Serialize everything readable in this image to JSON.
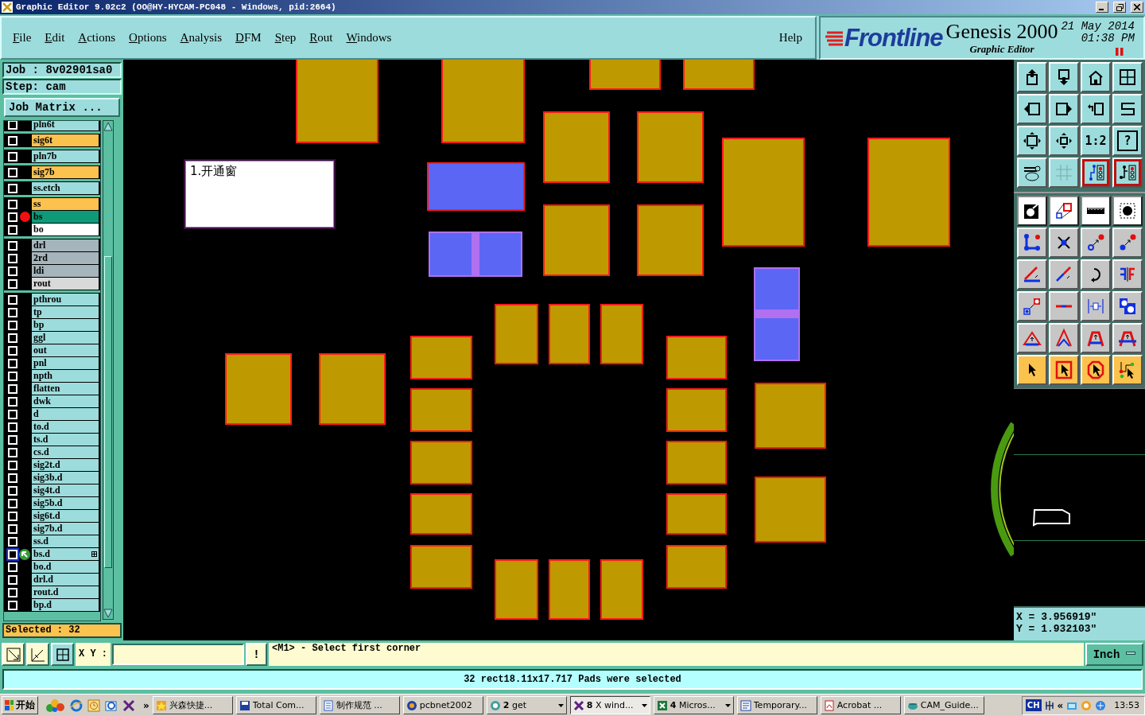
{
  "window": {
    "title": "Graphic Editor 9.02c2 (OO@HY-HYCAM-PC048 - Windows, pid:2664)"
  },
  "menu": [
    {
      "label": "File"
    },
    {
      "label": "Edit"
    },
    {
      "label": "Actions"
    },
    {
      "label": "Options"
    },
    {
      "label": "Analysis"
    },
    {
      "label": "DFM"
    },
    {
      "label": "Step"
    },
    {
      "label": "Rout"
    },
    {
      "label": "Windows"
    }
  ],
  "help": "Help",
  "brand": {
    "logo": "Frontline",
    "product": "Genesis 2000",
    "date": "21 May 2014",
    "time": "01:38 PM",
    "subtitle": "Graphic Editor"
  },
  "job": {
    "job": "Job : 8v02901sa0",
    "step": "Step: cam",
    "matrix_button": "Job Matrix ..."
  },
  "layer_groups": [
    {
      "layers": [
        {
          "name": "pln6t",
          "color": "#9ddcdc",
          "checked": false,
          "work": false,
          "current": false
        }
      ]
    },
    {
      "layers": [
        {
          "name": "sig6t",
          "color": "#fbc24e",
          "checked": false,
          "work": false,
          "current": false
        }
      ]
    },
    {
      "layers": [
        {
          "name": "pln7b",
          "color": "#9ddcdc",
          "checked": false,
          "work": false,
          "current": false
        }
      ]
    },
    {
      "layers": [
        {
          "name": "sig7b",
          "color": "#fbc24e",
          "checked": false,
          "work": false,
          "current": false
        }
      ]
    },
    {
      "layers": [
        {
          "name": "ss.etch",
          "color": "#9ddcdc",
          "checked": false,
          "work": false,
          "current": false
        }
      ]
    },
    {
      "layers": [
        {
          "name": "ss",
          "color": "#fbc24e",
          "checked": false,
          "work": false,
          "current": false
        },
        {
          "name": "bs",
          "color": "#0e9a78",
          "checked": false,
          "work": true,
          "current": false
        },
        {
          "name": "bo",
          "color": "#ffffff",
          "checked": false,
          "work": false,
          "current": false
        }
      ]
    },
    {
      "layers": [
        {
          "name": "drl",
          "color": "#a5b5bb",
          "checked": false,
          "work": false,
          "current": false
        },
        {
          "name": "2rd",
          "color": "#a5b5bb",
          "checked": false,
          "work": false,
          "current": false
        },
        {
          "name": "ldi",
          "color": "#a5b5bb",
          "checked": false,
          "work": false,
          "current": false
        },
        {
          "name": "rout",
          "color": "#d9d9d9",
          "checked": false,
          "work": false,
          "current": false
        }
      ]
    },
    {
      "layers": [
        {
          "name": "pthrou",
          "color": "#9ddcdc",
          "checked": false,
          "work": false,
          "current": false
        },
        {
          "name": "tp",
          "color": "#9ddcdc",
          "checked": false,
          "work": false,
          "current": false
        },
        {
          "name": "bp",
          "color": "#9ddcdc",
          "checked": false,
          "work": false,
          "current": false
        },
        {
          "name": "ggl",
          "color": "#9ddcdc",
          "checked": false,
          "work": false,
          "current": false
        },
        {
          "name": "out",
          "color": "#9ddcdc",
          "checked": false,
          "work": false,
          "current": false
        },
        {
          "name": "pnl",
          "color": "#9ddcdc",
          "checked": false,
          "work": false,
          "current": false
        },
        {
          "name": "npth",
          "color": "#9ddcdc",
          "checked": false,
          "work": false,
          "current": false
        },
        {
          "name": "flatten",
          "color": "#9ddcdc",
          "checked": false,
          "work": false,
          "current": false
        },
        {
          "name": "dwk",
          "color": "#9ddcdc",
          "checked": false,
          "work": false,
          "current": false
        },
        {
          "name": "d",
          "color": "#9ddcdc",
          "checked": false,
          "work": false,
          "current": false
        },
        {
          "name": "to.d",
          "color": "#9ddcdc",
          "checked": false,
          "work": false,
          "current": false
        },
        {
          "name": "ts.d",
          "color": "#9ddcdc",
          "checked": false,
          "work": false,
          "current": false
        },
        {
          "name": "cs.d",
          "color": "#9ddcdc",
          "checked": false,
          "work": false,
          "current": false
        },
        {
          "name": "sig2t.d",
          "color": "#9ddcdc",
          "checked": false,
          "work": false,
          "current": false
        },
        {
          "name": "sig3b.d",
          "color": "#9ddcdc",
          "checked": false,
          "work": false,
          "current": false
        },
        {
          "name": "sig4t.d",
          "color": "#9ddcdc",
          "checked": false,
          "work": false,
          "current": false
        },
        {
          "name": "sig5b.d",
          "color": "#9ddcdc",
          "checked": false,
          "work": false,
          "current": false
        },
        {
          "name": "sig6t.d",
          "color": "#9ddcdc",
          "checked": false,
          "work": false,
          "current": false
        },
        {
          "name": "sig7b.d",
          "color": "#9ddcdc",
          "checked": false,
          "work": false,
          "current": false
        },
        {
          "name": "ss.d",
          "color": "#9ddcdc",
          "checked": false,
          "work": false,
          "current": false
        },
        {
          "name": "bs.d",
          "color": "#9ddcdc",
          "checked": false,
          "work": false,
          "current": true
        },
        {
          "name": "bo.d",
          "color": "#9ddcdc",
          "checked": false,
          "work": false,
          "current": false
        },
        {
          "name": "drl.d",
          "color": "#9ddcdc",
          "checked": false,
          "work": false,
          "current": false
        },
        {
          "name": "rout.d",
          "color": "#9ddcdc",
          "checked": false,
          "work": false,
          "current": false
        },
        {
          "name": "bp.d",
          "color": "#9ddcdc",
          "checked": false,
          "work": false,
          "current": false
        }
      ]
    }
  ],
  "selected_count": "Selected : 32",
  "canvas": {
    "note": "1.开通窗",
    "pads": [
      {
        "kind": "rect",
        "color": "#bf9900",
        "selected": true
      },
      {
        "kind": "rect",
        "color": "#bf9900",
        "selected": true
      },
      {
        "kind": "rect",
        "color": "#bf9900",
        "selected": true
      },
      {
        "kind": "rect",
        "color": "#bf9900",
        "selected": true
      },
      {
        "kind": "rect",
        "color": "#bf9900",
        "selected": true
      },
      {
        "kind": "rect",
        "color": "#bf9900",
        "selected": true
      },
      {
        "kind": "rect",
        "color": "#bf9900",
        "selected": true
      },
      {
        "kind": "rect",
        "color": "#bf9900",
        "selected": true
      },
      {
        "kind": "rect",
        "color": "#bf9900",
        "selected": true
      },
      {
        "kind": "rect",
        "color": "#bf9900",
        "selected": true
      },
      {
        "kind": "rect",
        "color": "#bf9900",
        "selected": true
      },
      {
        "kind": "rect",
        "color": "#bf9900",
        "selected": true
      },
      {
        "kind": "rect",
        "color": "#bf9900",
        "selected": true
      },
      {
        "kind": "rect",
        "color": "#bf9900",
        "selected": true
      },
      {
        "kind": "rect",
        "color": "#bf9900",
        "selected": true
      },
      {
        "kind": "rect",
        "color": "#bf9900",
        "selected": true
      },
      {
        "kind": "rect",
        "color": "#bf9900",
        "selected": true
      },
      {
        "kind": "rect",
        "color": "#bf9900",
        "selected": true
      },
      {
        "kind": "rect",
        "color": "#bf9900",
        "selected": true
      },
      {
        "kind": "rect",
        "color": "#bf9900",
        "selected": true
      },
      {
        "kind": "rect",
        "color": "#bf9900",
        "selected": true
      },
      {
        "kind": "rect",
        "color": "#bf9900",
        "selected": true
      },
      {
        "kind": "rect",
        "color": "#bf9900",
        "selected": true
      },
      {
        "kind": "rect",
        "color": "#bf9900",
        "selected": true
      },
      {
        "kind": "rect",
        "color": "#bf9900",
        "selected": true
      },
      {
        "kind": "rect",
        "color": "#bf9900",
        "selected": true
      },
      {
        "kind": "rect",
        "color": "#bf9900",
        "selected": true
      },
      {
        "kind": "rect",
        "color": "#bf9900",
        "selected": true
      },
      {
        "kind": "rect",
        "color": "#bf9900",
        "selected": true
      },
      {
        "kind": "rect",
        "color": "#bf9900",
        "selected": true
      },
      {
        "kind": "rect",
        "color": "#5b66f5",
        "selected": true
      },
      {
        "kind": "split_v",
        "color": "#5b66f5",
        "selected": false
      },
      {
        "kind": "split_h",
        "color": "#5b66f5",
        "selected": false
      }
    ]
  },
  "tools": [
    {
      "kind": "view",
      "on": false
    },
    {
      "kind": "view",
      "on": false
    },
    {
      "kind": "view",
      "on": false
    },
    {
      "kind": "view",
      "on": false
    },
    {
      "kind": "view",
      "on": false
    },
    {
      "kind": "view",
      "on": false
    },
    {
      "kind": "view",
      "on": false
    },
    {
      "kind": "view",
      "on": false
    },
    {
      "kind": "view",
      "on": false
    },
    {
      "kind": "view",
      "on": false
    },
    {
      "kind": "view",
      "label": "1:2",
      "on": false
    },
    {
      "kind": "view",
      "label": "?",
      "on": false
    },
    {
      "kind": "view",
      "on": false
    },
    {
      "kind": "view",
      "on": false
    },
    {
      "kind": "view",
      "on": true
    },
    {
      "kind": "view",
      "on": true
    },
    {
      "kind": "mode",
      "on": false
    },
    {
      "kind": "mode",
      "on": false
    },
    {
      "kind": "mode",
      "on": false
    },
    {
      "kind": "mode",
      "on": false
    },
    {
      "kind": "edit",
      "on": false
    },
    {
      "kind": "edit",
      "on": false
    },
    {
      "kind": "edit",
      "on": false
    },
    {
      "kind": "edit",
      "on": false
    },
    {
      "kind": "edit",
      "on": false
    },
    {
      "kind": "edit",
      "on": false
    },
    {
      "kind": "edit",
      "on": false
    },
    {
      "kind": "edit",
      "on": false
    },
    {
      "kind": "edit",
      "on": false
    },
    {
      "kind": "edit",
      "on": false
    },
    {
      "kind": "edit",
      "on": false
    },
    {
      "kind": "edit",
      "on": false
    },
    {
      "kind": "edit",
      "on": false
    },
    {
      "kind": "edit",
      "on": false
    },
    {
      "kind": "edit",
      "on": false
    },
    {
      "kind": "edit",
      "on": false
    },
    {
      "kind": "select",
      "on": false
    },
    {
      "kind": "select",
      "on": false
    },
    {
      "kind": "select",
      "on": false
    },
    {
      "kind": "select",
      "on": false
    }
  ],
  "coords": {
    "x": "X = 3.956919\"",
    "y": "Y = 1.932103\""
  },
  "command": {
    "xy_label": "X Y :",
    "bang": "!",
    "prompt": "<M1> - Select first corner",
    "units": "Inch"
  },
  "status": "32 rect18.11x17.717 Pads were selected",
  "taskbar": {
    "start": "开始",
    "more": "»",
    "tasks": [
      {
        "label": "兴森快捷...",
        "kind": "single",
        "selected": false
      },
      {
        "label": "Total Com...",
        "kind": "single",
        "selected": false
      },
      {
        "label": "制作规范 ...",
        "kind": "single",
        "selected": false
      },
      {
        "label": "pcbnet2002",
        "kind": "single",
        "selected": false
      },
      {
        "count": "2",
        "label": "get",
        "kind": "group",
        "selected": false
      },
      {
        "count": "8",
        "label": "X wind...",
        "kind": "group",
        "selected": true
      },
      {
        "count": "4",
        "label": "Micros...",
        "kind": "group",
        "selected": false
      },
      {
        "label": "Temporary...",
        "kind": "single",
        "selected": false
      },
      {
        "label": "Acrobat ...",
        "kind": "single",
        "selected": false
      },
      {
        "label": "CAM_Guide...",
        "kind": "single",
        "selected": false
      }
    ],
    "tray_lang": "CH",
    "tray_more": "«",
    "clock": "13:53"
  }
}
